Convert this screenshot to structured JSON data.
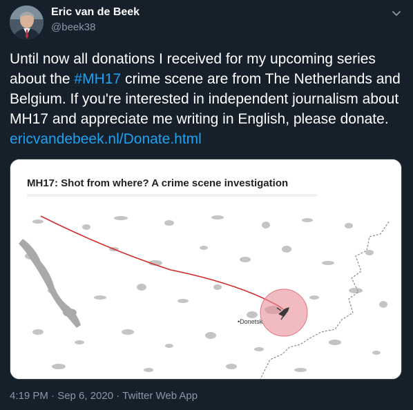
{
  "user": {
    "name": "Eric van de Beek",
    "handle": "@beek38"
  },
  "tweet": {
    "text_before": "Until now all donations I received for my upcoming series about the ",
    "hashtag": "#MH17",
    "text_middle": " crime scene are from The Netherlands and Belgium. If you're interested in independent journalism about MH17 and appreciate me writing in English, please donate. ",
    "link": "ericvandebeek.nl/Donate.html"
  },
  "media": {
    "title": "MH17: Shot from where? A crime scene investigation",
    "city_label": "•Donetsk"
  },
  "footer": {
    "meta": "4:19 PM · Sep 6, 2020 · Twitter Web App"
  },
  "colors": {
    "background": "#15202b",
    "accent": "#1da1f2",
    "secondary_text": "#8899a6"
  },
  "icons": {
    "more": "chevron-down-icon"
  }
}
